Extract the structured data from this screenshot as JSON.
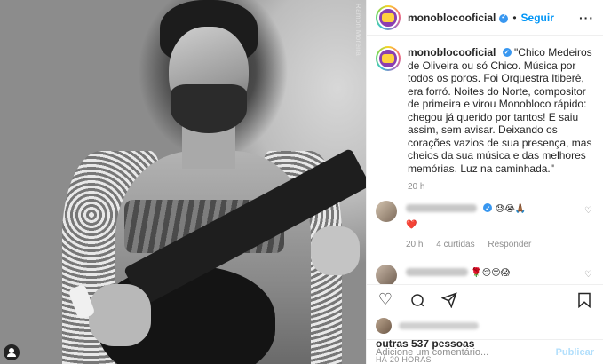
{
  "photo": {
    "watermark": "Ramon Moreira"
  },
  "header": {
    "username": "monoblocooficial",
    "separator": "•",
    "follow_label": "Seguir",
    "more_label": "···"
  },
  "caption": {
    "username": "monoblocooficial",
    "text": "\"Chico Medeiros de Oliveira ou só Chico. Música por todos os poros. Foi Orquestra Itiberê, era forró. Noites do Norte, compositor de primeira e virou Monobloco rápido: chegou já querido por tantos! E saiu assim, sem avisar. Deixando os corações vazios de sua presença, mas cheios da sua música e das melhores memórias. Luz na caminhada.\"",
    "time": "20 h"
  },
  "comments": [
    {
      "emojis": "😓😭🙏🏾",
      "emoji_line2": "❤️",
      "time": "20 h",
      "likes": "4 curtidas",
      "reply": "Responder"
    },
    {
      "emojis": "🌹😔😔😱"
    }
  ],
  "likes": {
    "others": "outras 537 pessoas",
    "posted_ago": "HÁ 20 HORAS"
  },
  "add_comment": {
    "placeholder": "Adicione um comentário...",
    "publish_label": "Publicar"
  }
}
